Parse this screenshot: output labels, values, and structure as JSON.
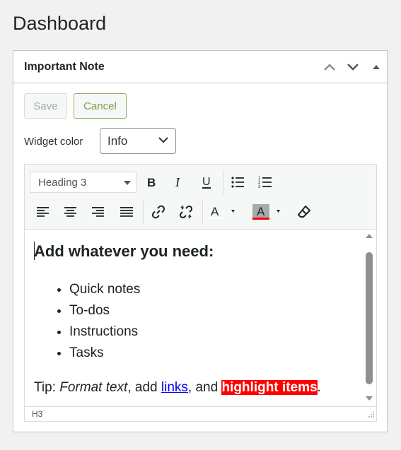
{
  "page": {
    "title": "Dashboard"
  },
  "widget": {
    "title": "Important Note",
    "save_label": "Save",
    "cancel_label": "Cancel",
    "color_label": "Widget color",
    "color_value": "Info"
  },
  "editor": {
    "format_value": "Heading 3",
    "heading": "Add whatever you need:",
    "list": [
      "Quick notes",
      "To-dos",
      "Instructions",
      "Tasks"
    ],
    "tip": {
      "prefix": "Tip: ",
      "italic": "Format text",
      "mid1": ", add ",
      "link": "links",
      "mid2": ", and ",
      "highlight": "highlight items",
      "suffix": "."
    },
    "status": "H3"
  },
  "icons": {
    "header": [
      "chevron-up-icon",
      "chevron-down-icon",
      "triangle-up-icon"
    ],
    "toolbar": [
      "bold-icon",
      "italic-icon",
      "underline-icon",
      "bullet-list-icon",
      "numbered-list-icon",
      "align-left-icon",
      "align-center-icon",
      "align-right-icon",
      "justify-icon",
      "link-icon",
      "unlink-icon",
      "text-color-icon",
      "background-color-icon",
      "eraser-icon"
    ]
  },
  "colors": {
    "highlight": "#ff0000",
    "link": "#0000ee",
    "cancel_border": "#8cb360",
    "text_color_bar": "#ff0000"
  }
}
